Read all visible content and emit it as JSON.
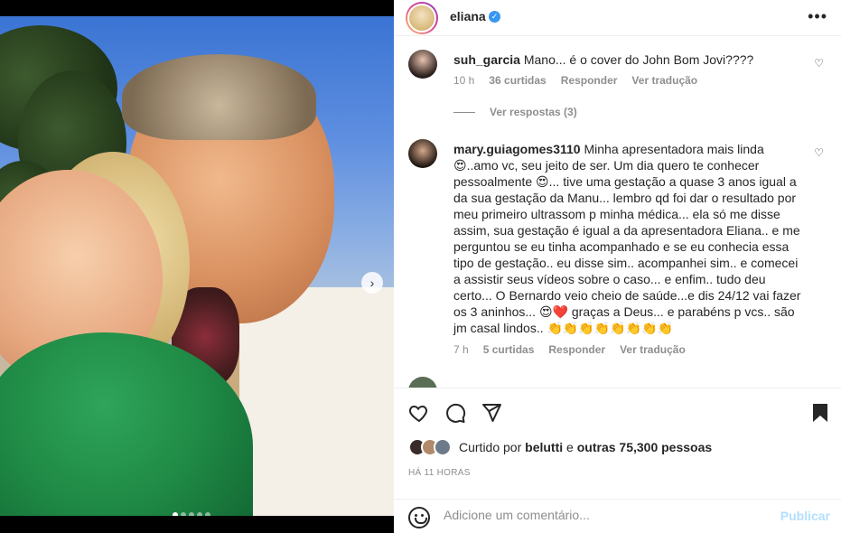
{
  "header": {
    "username": "eliana",
    "more": "•••"
  },
  "comments": [
    {
      "username": "suh_garcia",
      "text": "Mano... é o cover do John Bom Jovi????",
      "time": "10 h",
      "likes": "36 curtidas",
      "reply": "Responder",
      "translate": "Ver tradução"
    },
    {
      "username": "mary.guiagomes3110",
      "text": "Minha apresentadora mais linda😍..amo vc, seu jeito de ser. Um dia quero te conhecer pessoalmente 😍... tive uma gestação a quase 3 anos igual a da sua gestação da Manu... lembro qd foi dar o resultado por meu primeiro ultrassom p minha médica... ela só me disse assim, sua gestação é igual a da apresentadora Eliana.. e me perguntou se eu tinha acompanhado e se eu conhecia essa tipo de gestação.. eu disse sim.. acompanhei sim.. e comecei a assistir seus vídeos sobre o caso... e enfim.. tudo deu certo... O Bernardo veio cheio de saúde...e dis 24/12 vai fazer os 3 aninhos... 😍❤️ graças a Deus... e parabéns p vcs.. são jm casal lindos.. 👏👏👏👏👏👏👏👏",
      "time": "7 h",
      "likes": "5 curtidas",
      "reply": "Responder",
      "translate": "Ver tradução"
    }
  ],
  "view_replies": "Ver respostas (3)",
  "liked": {
    "prefix": "Curtido por",
    "user": "belutti",
    "connector": "e",
    "others": "outras 75,300 pessoas"
  },
  "timestamp": "HÁ 11 HORAS",
  "add_comment": {
    "placeholder": "Adicione um comentário...",
    "post_label": "Publicar"
  },
  "colors": {
    "accent": "#0095f6",
    "post_disabled": "#b2dffc",
    "verified": "#3897f0"
  }
}
